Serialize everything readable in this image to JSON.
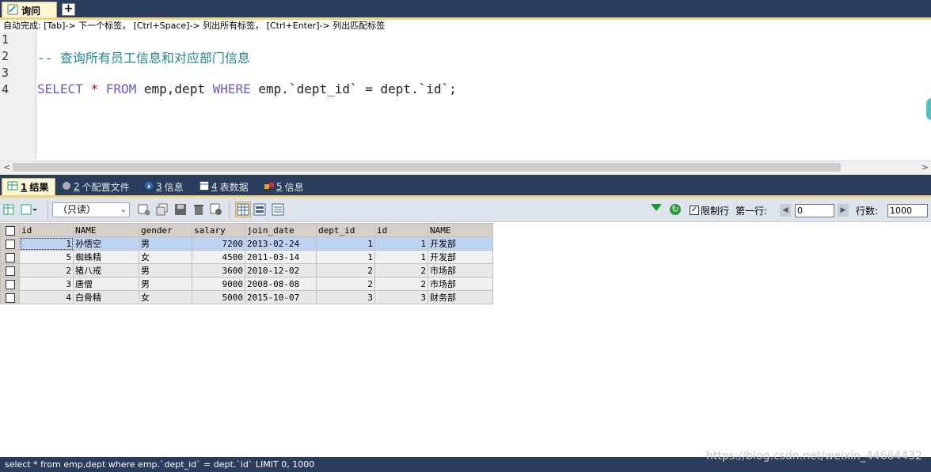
{
  "tabs": {
    "query_label": "询问",
    "add_label": "+"
  },
  "hint": "自动完成: [Tab]-> 下一个标签， [Ctrl+Space]-> 列出所有标签， [Ctrl+Enter]-> 列出匹配标签",
  "editor": {
    "line_numbers": [
      "1",
      "2",
      "3",
      "4"
    ],
    "comment": "-- 查询所有员工信息和对应部门信息",
    "sql_parts": {
      "select": "SELECT",
      "star": "*",
      "from": "FROM",
      "tables": "emp,dept",
      "where": "WHERE",
      "condition": "emp.`dept_id` = dept.`id`;"
    }
  },
  "result_tabs": [
    {
      "num": "1",
      "label": "结果"
    },
    {
      "num": "2",
      "label": "个配置文件"
    },
    {
      "num": "3",
      "label": "信息"
    },
    {
      "num": "4",
      "label": "表数据"
    },
    {
      "num": "5",
      "label": "信息"
    }
  ],
  "toolbar": {
    "mode_select": "（只读）",
    "limit_label": "限制行",
    "first_row_label": "第一行:",
    "first_row_value": "0",
    "rows_label": "行数:",
    "rows_value": "1000"
  },
  "grid": {
    "columns": [
      "id",
      "NAME",
      "gender",
      "salary",
      "join_date",
      "dept_id",
      "id",
      "NAME"
    ],
    "rows": [
      [
        "1",
        "孙悟空",
        "男",
        "7200",
        "2013-02-24",
        "1",
        "1",
        "开发部"
      ],
      [
        "5",
        "蜘蛛精",
        "女",
        "4500",
        "2011-03-14",
        "1",
        "1",
        "开发部"
      ],
      [
        "2",
        "猪八戒",
        "男",
        "3600",
        "2010-12-02",
        "2",
        "2",
        "市场部"
      ],
      [
        "3",
        "唐僧",
        "男",
        "9000",
        "2008-08-08",
        "2",
        "2",
        "市场部"
      ],
      [
        "4",
        "白骨精",
        "女",
        "5000",
        "2015-10-07",
        "3",
        "3",
        "财务部"
      ]
    ]
  },
  "status": "select * from emp,dept where emp.`dept_id` = dept.`id` LIMIT 0, 1000",
  "watermark": "https://blog.csdn.net/weixin_44664432",
  "colors": {
    "frame": "#2b3d5c",
    "tab_active": "#fdf6d3",
    "accent": "#f0d57a",
    "keyword": "#6a5acd",
    "comment": "#1e8a8a"
  }
}
